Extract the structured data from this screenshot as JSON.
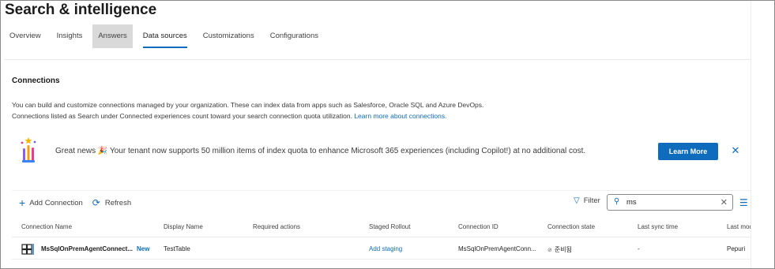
{
  "page": {
    "title": "Search & intelligence"
  },
  "tabs": [
    {
      "label": "Overview"
    },
    {
      "label": "Insights"
    },
    {
      "label": "Answers"
    },
    {
      "label": "Data sources"
    },
    {
      "label": "Customizations"
    },
    {
      "label": "Configurations"
    }
  ],
  "active_tab": "Data sources",
  "section": {
    "title": "Connections",
    "desc_line1": "You can build and customize connections managed by your organization. These can index data from apps such as Salesforce, Oracle SQL and Azure DevOps.",
    "desc_line2": "Connections listed as Search under Connected experiences count toward your search connection quota utilization.",
    "learn_link": "Learn more about connections."
  },
  "banner": {
    "text": "Great news 🎉 Your tenant now supports 50 million items of index quota to enhance Microsoft 365 experiences (including Copilot!) at no additional cost.",
    "button_label": "Learn More",
    "close_icon": "close-icon"
  },
  "toolbar": {
    "add_label": "Add Connection",
    "refresh_label": "Refresh",
    "filter_label": "Filter",
    "search_value": "ms"
  },
  "table": {
    "columns": [
      "Connection Name",
      "Display Name",
      "Required actions",
      "Staged Rollout",
      "Connection ID",
      "Connection state",
      "Last sync time",
      "Last modified by"
    ],
    "rows": [
      {
        "name": "MsSqlOnPremAgentConnect...",
        "badge": "New",
        "display_name": "TestTable",
        "required_actions": "",
        "staged_rollout": "Add staging",
        "connection_id": "MsSqlOnPremAgentConn...",
        "state": "준비됨",
        "last_sync": "-",
        "modified_by": "Pepuri"
      }
    ]
  },
  "colors": {
    "accent": "#0f6cbd",
    "text": "#242424"
  }
}
